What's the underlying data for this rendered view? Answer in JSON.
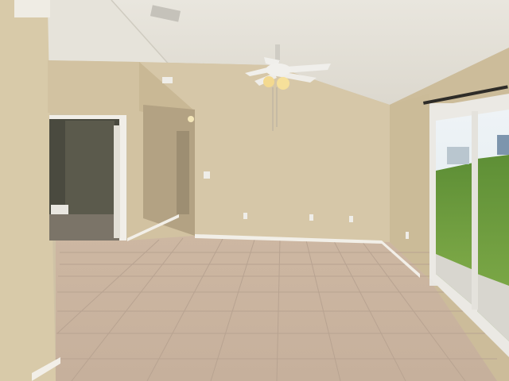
{
  "scene": {
    "description_colors": {
      "ceiling": "#e4e1d8",
      "wall_back": "#d6c7a8",
      "wall_left": "#d9cbab",
      "wall_right": "#cbbb99",
      "floor": "#c9b4a0",
      "baseboard": "#f2efe8",
      "grass": "#6f9e3f",
      "glass_frame": "#eceae6"
    }
  }
}
